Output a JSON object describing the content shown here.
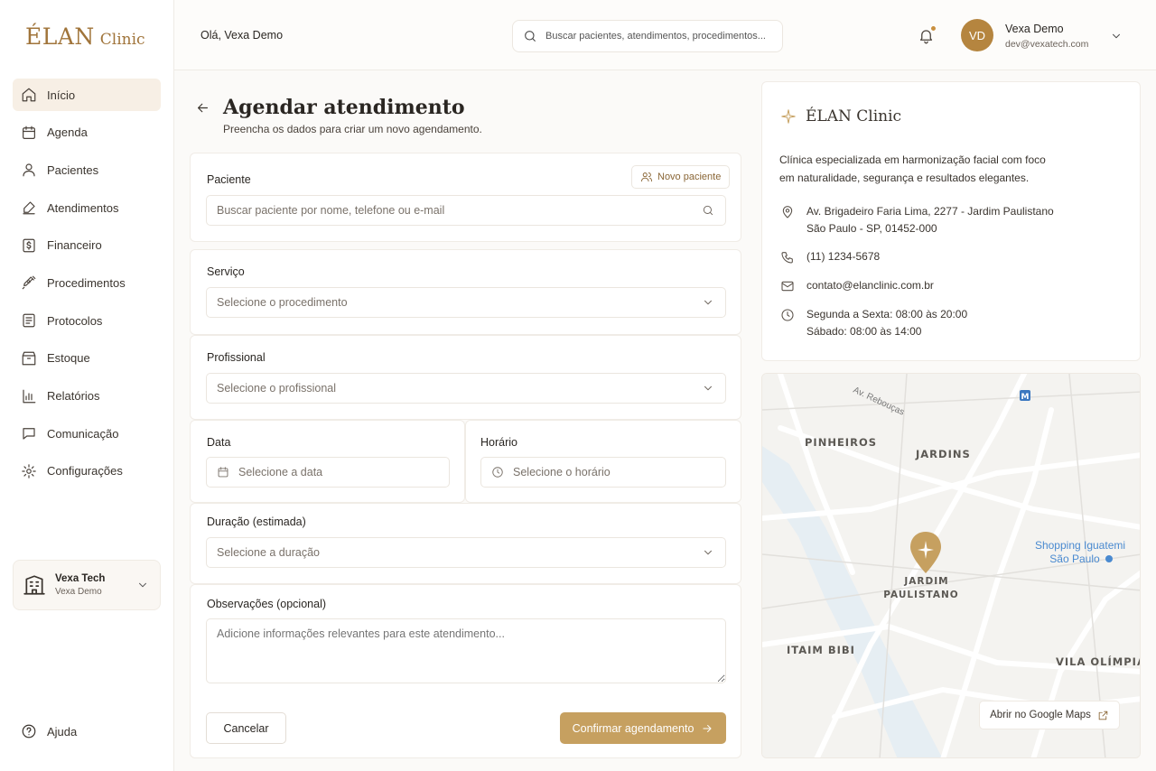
{
  "brand": {
    "name": "ÉLAN",
    "suffix": "Clinic"
  },
  "sidebar": {
    "items": [
      {
        "label": "Início"
      },
      {
        "label": "Agenda"
      },
      {
        "label": "Pacientes"
      },
      {
        "label": "Atendimentos"
      },
      {
        "label": "Financeiro"
      },
      {
        "label": "Procedimentos"
      },
      {
        "label": "Protocolos"
      },
      {
        "label": "Estoque"
      },
      {
        "label": "Relatórios"
      },
      {
        "label": "Comunicação"
      },
      {
        "label": "Configurações"
      }
    ],
    "active": "Início",
    "workspace": {
      "name": "Vexa Tech",
      "user": "Vexa Demo"
    },
    "help": "Ajuda"
  },
  "header": {
    "greeting": "Olá, Vexa Demo",
    "search_placeholder": "Buscar pacientes, atendimentos, procedimentos...",
    "user": {
      "initials": "VD",
      "name": "Vexa Demo",
      "email": "dev@vexatech.com"
    }
  },
  "form": {
    "title": "Agendar atendimento",
    "subtitle": "Preencha os dados para criar um novo agendamento.",
    "patient": {
      "label": "Paciente",
      "new_button": "Novo paciente",
      "placeholder": "Buscar paciente por nome, telefone ou e-mail"
    },
    "service": {
      "label": "Serviço",
      "placeholder": "Selecione o procedimento"
    },
    "professional": {
      "label": "Profissional",
      "placeholder": "Selecione o profissional"
    },
    "date": {
      "label": "Data",
      "placeholder": "Selecione a data"
    },
    "time": {
      "label": "Horário",
      "placeholder": "Selecione o horário"
    },
    "duration": {
      "label": "Duração (estimada)",
      "placeholder": "Selecione a duração"
    },
    "notes": {
      "label": "Observações (opcional)",
      "placeholder": "Adicione informações relevantes para este atendimento..."
    },
    "cancel": "Cancelar",
    "confirm": "Confirmar agendamento"
  },
  "clinic": {
    "name": "ÉLAN Clinic",
    "description": "Clínica especializada em harmonização facial com foco em naturalidade, segurança e resultados elegantes.",
    "address_line1": "Av. Brigadeiro Faria Lima, 2277 - Jardim Paulistano",
    "address_line2": "São Paulo - SP, 01452-000",
    "phone": "(11) 1234-5678",
    "email": "contato@elanclinic.com.br",
    "hours_line1": "Segunda a Sexta: 08:00 às 20:00",
    "hours_line2": "Sábado: 08:00 às 14:00"
  },
  "map": {
    "labels": {
      "pinheiros": "PINHEIROS",
      "jardins": "JARDINS",
      "jardim": "JARDIM",
      "paulistano": "PAULISTANO",
      "itaim": "ITAIM BIBI",
      "vila": "VILA OLÍMPIA",
      "shopping1": "Shopping Iguatemi",
      "shopping2": "São Paulo",
      "street_rebouças": "Av. Rebouças",
      "metro": "M"
    },
    "open_button": "Abrir no Google Maps"
  },
  "colors": {
    "accent": "#c6a060",
    "brand": "#a0743a",
    "map_bg": "#f4f3f0",
    "map_road": "#ffffff"
  }
}
